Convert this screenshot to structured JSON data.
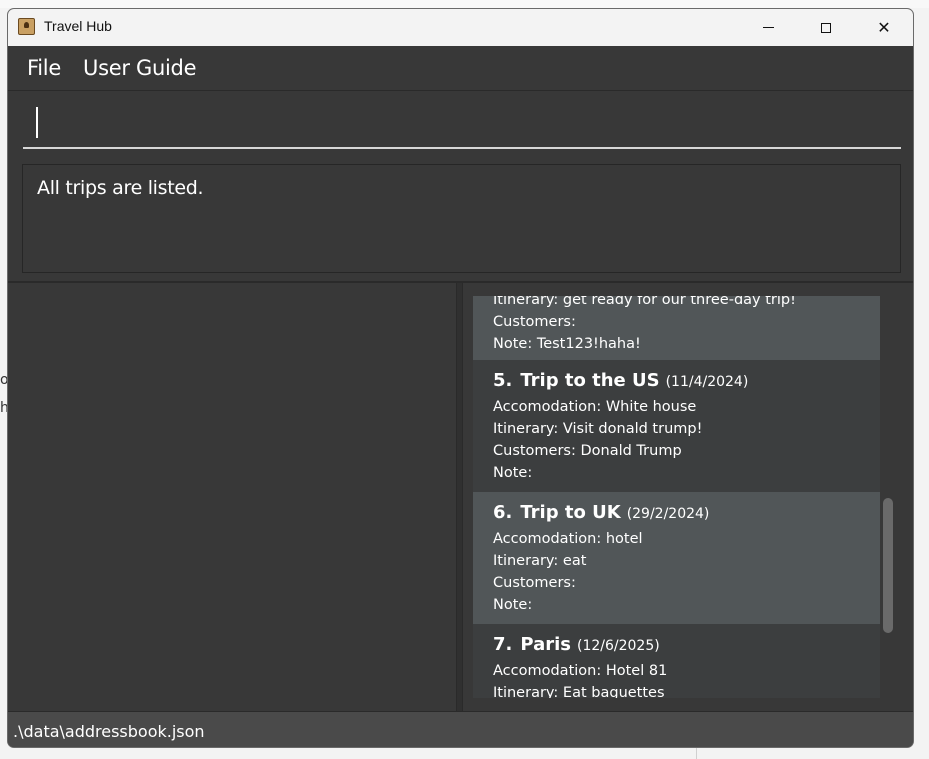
{
  "background": {
    "left_text_a": "o",
    "left_text_b": "h"
  },
  "window": {
    "title": "Travel Hub",
    "controls": {
      "minimize": "minimize",
      "maximize": "maximize",
      "close": "✕"
    }
  },
  "menu": {
    "file": "File",
    "user_guide": "User Guide"
  },
  "command": {
    "value": "",
    "placeholder": ""
  },
  "result": {
    "message": "All trips are listed."
  },
  "trips": [
    {
      "partial": true,
      "lines": [
        "Itinerary: get ready for our three-day trip!",
        "Customers:",
        "Note: Test123!haha!"
      ]
    },
    {
      "index": "5.",
      "name": "Trip to the US",
      "date": "(11/4/2024)",
      "lines": [
        "Accomodation: White house",
        "Itinerary: Visit donald trump!",
        "Customers: Donald Trump",
        "Note:"
      ]
    },
    {
      "index": "6.",
      "name": "Trip to UK",
      "date": "(29/2/2024)",
      "lines": [
        "Accomodation: hotel",
        "Itinerary: eat",
        "Customers:",
        "Note:"
      ]
    },
    {
      "index": "7.",
      "name": "Paris",
      "date": "(12/6/2025)",
      "lines": [
        "Accomodation: Hotel 81",
        "Itinerary: Eat baguettes"
      ]
    }
  ],
  "status": {
    "file_path": ".\\data\\addressbook.json"
  },
  "colors": {
    "accent_row": "#515658",
    "panel": "#383838",
    "status_bar": "#4a4a4a"
  }
}
